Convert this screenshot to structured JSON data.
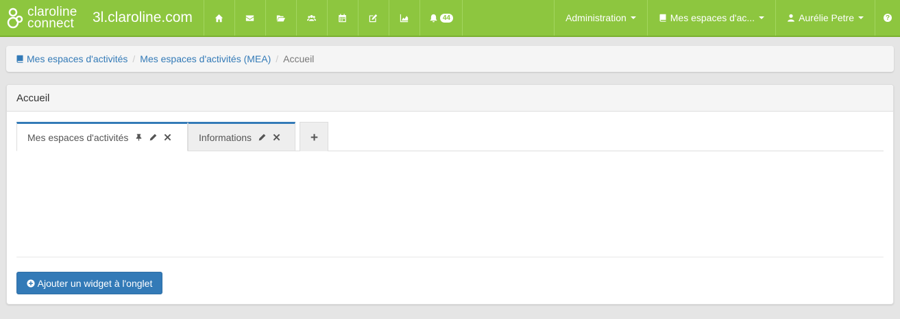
{
  "navbar": {
    "logo_line1": "claroline",
    "logo_line2": "connect",
    "brand": "3l.claroline.com",
    "icons": [
      "home-icon",
      "envelope-icon",
      "folder-open-icon",
      "users-icon",
      "calendar-icon",
      "edit-icon",
      "chart-icon",
      "bell-icon"
    ],
    "notifications_count": "44",
    "admin_label": "Administration",
    "workspaces_label": "Mes espaces d'ac...",
    "user_label": "Aurélie Petre",
    "help_label": "?",
    "colors": {
      "bar": "#8dc63f"
    }
  },
  "breadcrumb": {
    "item1": "Mes espaces d'activités",
    "item2": "Mes espaces d'activités (MEA)",
    "item3": "Accueil"
  },
  "panel": {
    "title": "Accueil",
    "tabs": [
      {
        "label": "Mes espaces d'activités"
      },
      {
        "label": "Informations"
      }
    ],
    "add_widget_label": "Ajouter un widget à l'onglet"
  }
}
